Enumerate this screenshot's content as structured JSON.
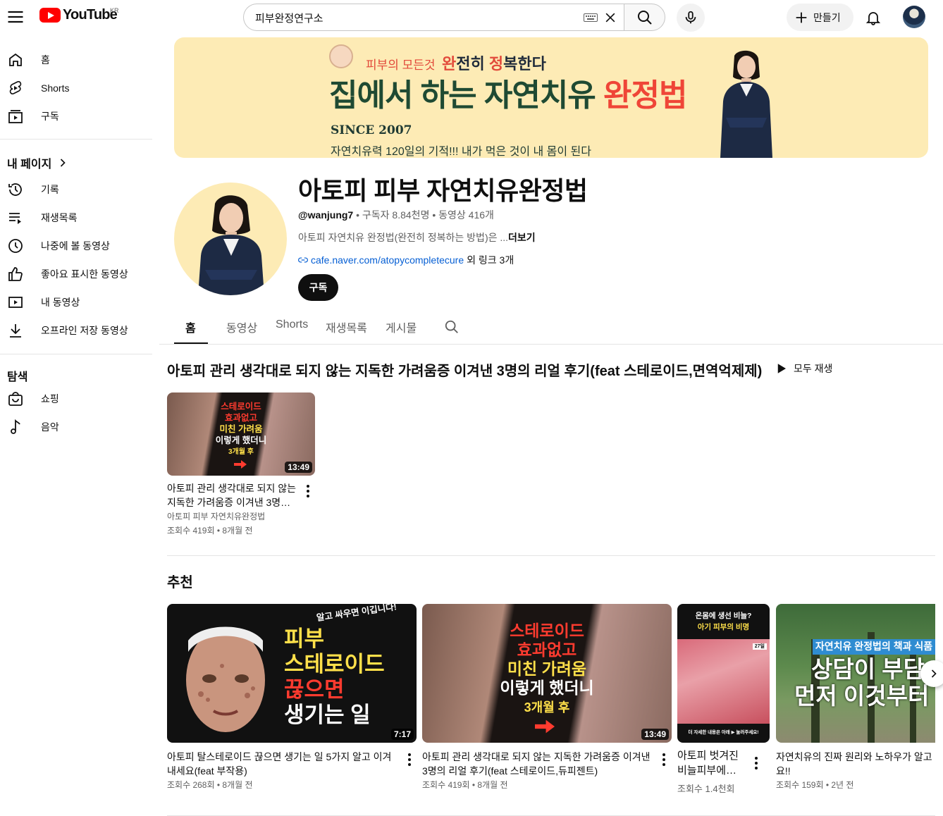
{
  "topbar": {
    "logo_text": "YouTube",
    "country_code": "KR",
    "search_value": "피부완정연구소",
    "create_label": "만들기"
  },
  "sidebar": {
    "main_items": [
      {
        "label": "홈",
        "icon": "home-icon"
      },
      {
        "label": "Shorts",
        "icon": "shorts-icon"
      },
      {
        "label": "구독",
        "icon": "subscriptions-icon"
      }
    ],
    "my_page_heading": "내 페이지",
    "my_items": [
      {
        "label": "기록",
        "icon": "history-icon"
      },
      {
        "label": "재생목록",
        "icon": "playlists-icon"
      },
      {
        "label": "나중에 볼 동영상",
        "icon": "watch-later-icon"
      },
      {
        "label": "좋아요 표시한 동영상",
        "icon": "liked-icon"
      },
      {
        "label": "내 동영상",
        "icon": "your-videos-icon"
      },
      {
        "label": "오프라인 저장 동영상",
        "icon": "downloads-icon"
      }
    ],
    "explore_heading": "탐색",
    "explore_items": [
      {
        "label": "쇼핑",
        "icon": "shopping-icon"
      },
      {
        "label": "음악",
        "icon": "music-icon"
      }
    ]
  },
  "banner": {
    "kicker_prefix": "피부의 모든것",
    "kicker_w1_big": "완",
    "kicker_w1_rest": "전히 ",
    "kicker_w2_big": "정",
    "kicker_w2_rest": "복한다",
    "title_main": "집에서 하는 자연치유 ",
    "title_accent": "완정법",
    "since": "SINCE 2007",
    "subtitle": "자연치유력 120일의 기적!!! 내가 먹은 것이 내 몸이 된다"
  },
  "channel": {
    "name": "아토피 피부 자연치유완정법",
    "handle": "@wanjung7",
    "subscribers": "구독자 8.84천명",
    "videos": "동영상 416개",
    "description": "아토피 자연치유 완정법(완전히 정복하는 방법)은 ...",
    "more_label": "더보기",
    "link": "cafe.naver.com/atopycompletecure",
    "extra_links": "외 링크 3개",
    "subscribe_label": "구독"
  },
  "tabs": [
    "홈",
    "동영상",
    "Shorts",
    "재생목록",
    "게시물"
  ],
  "section_featured": {
    "title": "아토피 관리 생각대로 되지 않는 지독한 가려움증 이겨낸 3명의 리얼 후기(feat 스테로이드,면역억제제)",
    "play_all_label": "모두 재생",
    "video": {
      "title_line1": "아토피 관리 생각대로 되지 않는",
      "title_line2": "지독한 가려움증 이겨낸 3명…",
      "channel": "아토피 피부 자연치유완정법",
      "meta": "조회수 419회 • 8개월 전",
      "duration": "13:49",
      "thumb_text": [
        "스테로이드",
        "효과없고",
        "미친 가려움",
        "이렇게 했더니",
        "3개월 후"
      ]
    }
  },
  "section_recommended": {
    "title": "추천",
    "videos": [
      {
        "title_line1": "아토피 탈스테로이드 끊으면 생기는 일 5가지 알고 이겨",
        "title_line2": "내세요(feat 부작용)",
        "meta": "조회수 268회 • 8개월 전",
        "duration": "7:17",
        "thumb_text": [
          "알고 싸우면 이깁니다!",
          "피부",
          "스테로이드",
          "끊으면",
          "생기는 일"
        ]
      },
      {
        "title_line1": "아토피 관리 생각대로 되지 않는 지독한 가려움증 이겨낸",
        "title_line2": "3명의 리얼 후기(feat 스테로이드,듀피젠트)",
        "meta": "조회수 419회 • 8개월 전",
        "duration": "13:49",
        "thumb_text": [
          "스테로이드",
          "효과없고",
          "미친 가려움",
          "이렇게 했더니",
          "3개월 후"
        ]
      },
      {
        "title_line1": "아토피 벗겨진",
        "title_line2": "비늘피부에…",
        "meta": "조회수 1.4천회",
        "thumb_text": [
          "온몸에 생선 비늘?",
          "아기 피부의 비명",
          "27일",
          "더 자세한 내용은 아래 ▶ 눌러주세요!"
        ]
      },
      {
        "title_line1": "자연치유의 진짜 원리와 노하우가 알고",
        "title_line2": "요!!",
        "meta": "조회수 159회 • 2년 전",
        "thumb_text": [
          "자연치유 완정법의 책과 식품",
          "상담이 부담",
          "먼저 이것부터"
        ]
      }
    ]
  },
  "colors": {
    "brand_red": "#ff0000",
    "link_blue": "#065fd4",
    "banner_bg": "#fdebb5",
    "banner_green": "#1f4a33",
    "banner_red": "#ef4537"
  }
}
